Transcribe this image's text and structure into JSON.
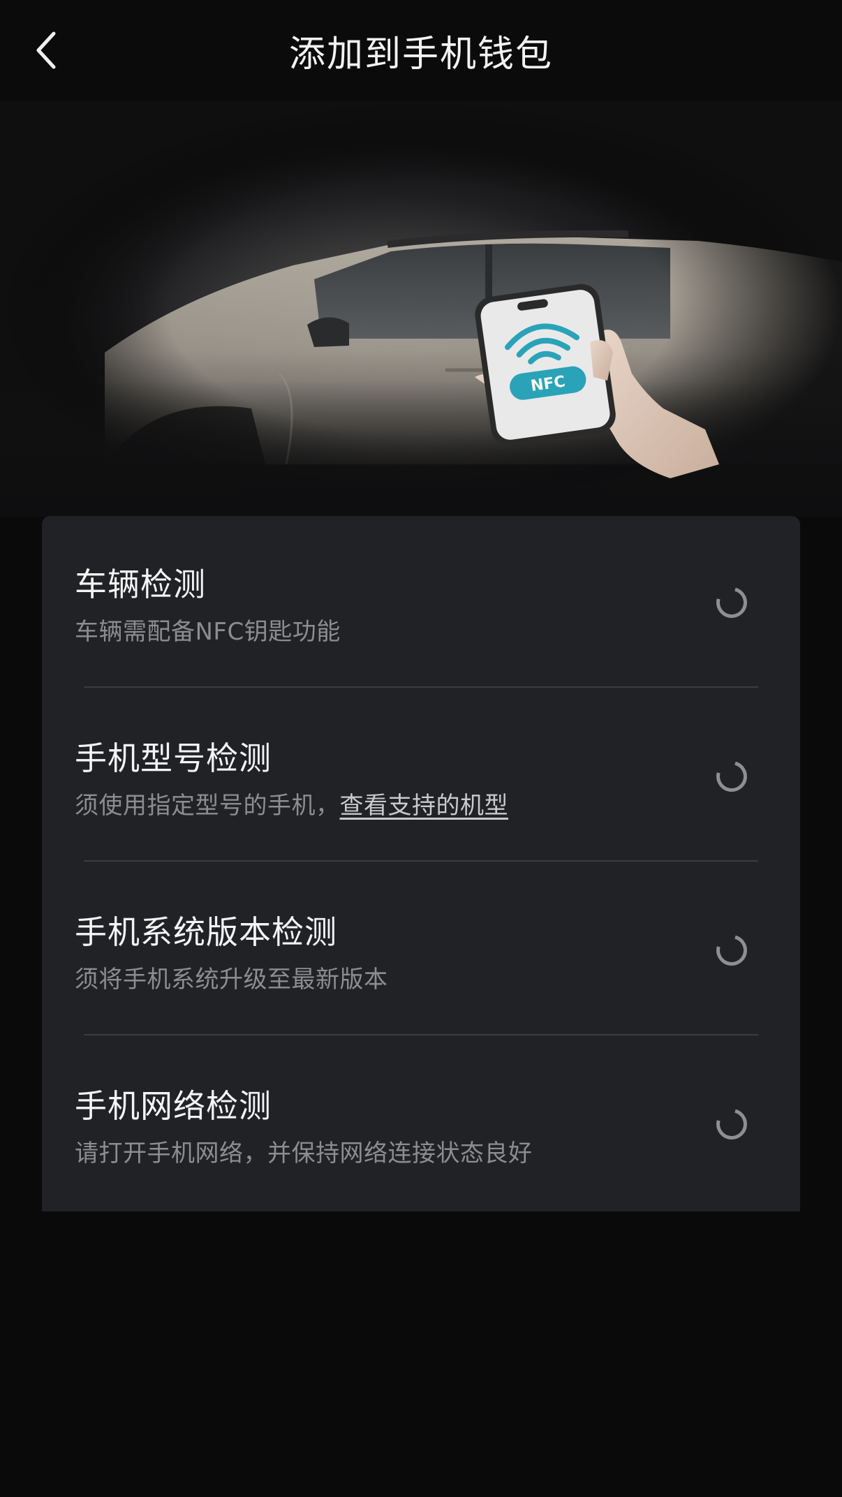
{
  "header": {
    "title": "添加到手机钱包"
  },
  "hero": {
    "nfc_badge": "NFC"
  },
  "checks": [
    {
      "title": "车辆检测",
      "desc": "车辆需配备NFC钥匙功能",
      "status": "loading"
    },
    {
      "title": "手机型号检测",
      "desc": "须使用指定型号的手机，",
      "link": "查看支持的机型",
      "status": "loading"
    },
    {
      "title": "手机系统版本检测",
      "desc": "须将手机系统升级至最新版本",
      "status": "loading"
    },
    {
      "title": "手机网络检测",
      "desc": "请打开手机网络，并保持网络连接状态良好",
      "status": "loading"
    }
  ],
  "colors": {
    "background": "#0a0a0b",
    "card": "#202226",
    "nfc_accent": "#2aa3b8",
    "desc_text": "#8c8d90"
  }
}
